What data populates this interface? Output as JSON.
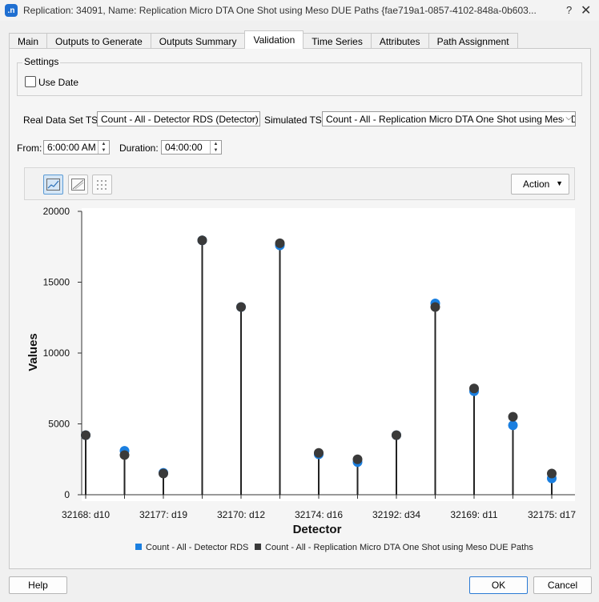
{
  "window": {
    "app_icon_text": ".n",
    "title": "Replication: 34091, Name: Replication Micro DTA One Shot using Meso DUE Paths  {fae719a1-0857-4102-848a-0b603...",
    "help_glyph": "?",
    "close_glyph": "✕"
  },
  "tabs": [
    {
      "label": "Main",
      "active": false
    },
    {
      "label": "Outputs to Generate",
      "active": false
    },
    {
      "label": "Outputs Summary",
      "active": false
    },
    {
      "label": "Validation",
      "active": true
    },
    {
      "label": "Time Series",
      "active": false
    },
    {
      "label": "Attributes",
      "active": false
    },
    {
      "label": "Path Assignment",
      "active": false
    }
  ],
  "settings": {
    "legend": "Settings",
    "use_date_label": "Use Date",
    "use_date_checked": false
  },
  "series_select": {
    "real_label": "Real Data Set TS:",
    "real_value": "Count - All - Detector RDS (Detector)",
    "sim_label": "Simulated TS:",
    "sim_value": "Count - All - Replication Micro DTA One Shot using Meso DUE"
  },
  "time": {
    "from_label": "From:",
    "from_value": "6:00:00 AM",
    "duration_label": "Duration:",
    "duration_value": "04:00:00"
  },
  "toolbar": {
    "action_label": "Action",
    "icons": [
      "line-chart-icon",
      "scatter-diagonal-icon",
      "grid-dots-icon"
    ]
  },
  "chart_data": {
    "type": "scatter",
    "xlabel": "Detector",
    "ylabel": "Values",
    "ylim": [
      0,
      20000
    ],
    "yticks": [
      0,
      5000,
      10000,
      15000,
      20000
    ],
    "categories": [
      "32168: d10",
      "",
      "32177: d19",
      "",
      "32170: d12",
      "",
      "32174: d16",
      "",
      "32192: d34",
      "",
      "32169: d11",
      "",
      "32175: d17"
    ],
    "series": [
      {
        "name": "Count - All - Detector RDS",
        "color": "#1a7fe0",
        "values": [
          4200,
          3100,
          1550,
          17950,
          13250,
          17600,
          2850,
          2300,
          4200,
          13500,
          7300,
          4900,
          1150
        ]
      },
      {
        "name": "Count - All - Replication Micro DTA One Shot using Meso DUE Paths",
        "color": "#3a3a3a",
        "values": [
          4200,
          2800,
          1500,
          17950,
          13250,
          17750,
          2950,
          2500,
          4200,
          13250,
          7500,
          5500,
          1500
        ]
      }
    ],
    "legend_position": "bottom",
    "grid": false
  },
  "footer": {
    "help_label": "Help",
    "ok_label": "OK",
    "cancel_label": "Cancel"
  }
}
